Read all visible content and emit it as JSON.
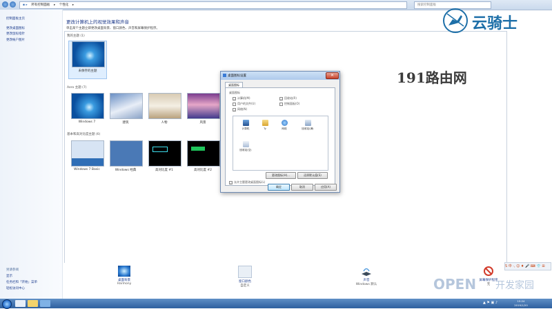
{
  "address_bar": {
    "crumbs": [
      "所有控制面板",
      "个性化"
    ],
    "search_placeholder": "搜索控制面板"
  },
  "sidebar": {
    "top_links": [
      "控制面板主页",
      "更改桌面图标",
      "更改鼠标指针",
      "更改帐户图片"
    ],
    "see_also_heading": "另请参阅",
    "bottom_links": [
      "显示",
      "任务栏和「开始」菜单",
      "轻松访问中心"
    ]
  },
  "main": {
    "title": "更改计算机上的视觉效果和声音",
    "subtitle": "单击某个主题立即更改桌面背景、窗口颜色、声音和屏幕保护程序。",
    "my_themes_label": "我的主题 (1)",
    "my_themes": [
      {
        "name": "未保存的主题",
        "style": "w7"
      }
    ],
    "aero_label": "Aero 主题 (7)",
    "aero_themes": [
      {
        "name": "Windows 7",
        "style": "w7"
      },
      {
        "name": "建筑",
        "style": "arch"
      },
      {
        "name": "人物",
        "style": "people"
      },
      {
        "name": "风景",
        "style": "scenery"
      }
    ],
    "basic_label": "基本和高对比度主题 (6)",
    "basic_themes": [
      {
        "name": "Windows 7 Basic",
        "style": "basic"
      },
      {
        "name": "Windows 经典",
        "style": "classic"
      },
      {
        "name": "高对比度 #1",
        "style": "hc1"
      },
      {
        "name": "高对比度 #2",
        "style": "hc2"
      }
    ]
  },
  "dialog": {
    "title": "桌面图标设置",
    "tab": "桌面图标",
    "group_label": "桌面图标",
    "checks": [
      {
        "label": "计算机(M)",
        "checked": true
      },
      {
        "label": "回收站(R)",
        "checked": true
      },
      {
        "label": "用户的文件(U)",
        "checked": false
      },
      {
        "label": "控制面板(O)",
        "checked": false
      },
      {
        "label": "网络(N)",
        "checked": true
      }
    ],
    "icons": [
      "计算机",
      "Ty",
      "网络",
      "回收站(满)",
      "回收站(空)"
    ],
    "change_icon_btn": "更改图标(H)...",
    "restore_default_btn": "还原默认值(S)",
    "allow_themes_label": "允许主题更改桌面图标(L)",
    "ok_btn": "确定",
    "cancel_btn": "取消",
    "apply_btn": "应用(A)"
  },
  "bottom": {
    "items": [
      {
        "title": "桌面背景",
        "sub": "Harmony"
      },
      {
        "title": "窗口颜色",
        "sub": "自定义"
      },
      {
        "title": "声音",
        "sub": "Windows 默认"
      },
      {
        "title": "屏幕保护程序",
        "sub": "无"
      }
    ]
  },
  "watermarks": {
    "brand": "云骑士",
    "site": "191路由网",
    "open_text": "OPEN",
    "open_sub": "开发家园"
  },
  "ime": {
    "text": "S 中 ·, ☺ ♦ 🎤 ⌨ 👕 ⊞"
  },
  "taskbar": {
    "time": "15:24",
    "date": "2019/1/20"
  }
}
